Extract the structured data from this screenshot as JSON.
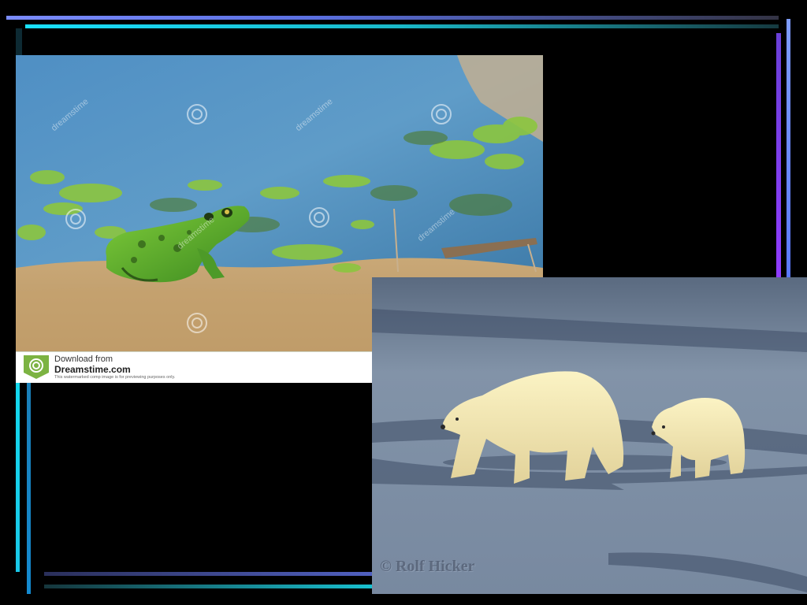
{
  "frog_photo": {
    "watermark_text": "dreamstime",
    "banner": {
      "line1": "Download from",
      "line2": "Dreamstime.com",
      "line3": "This watermarked comp image is for previewing purposes only."
    }
  },
  "bear_photo": {
    "credit": "© Rolf Hicker"
  },
  "colors": {
    "background": "#000000",
    "accent_blue": "#5a6fe0",
    "accent_cyan": "#19e0ff",
    "accent_purple": "#8f3cff",
    "dreamstime_green": "#7cb342"
  }
}
